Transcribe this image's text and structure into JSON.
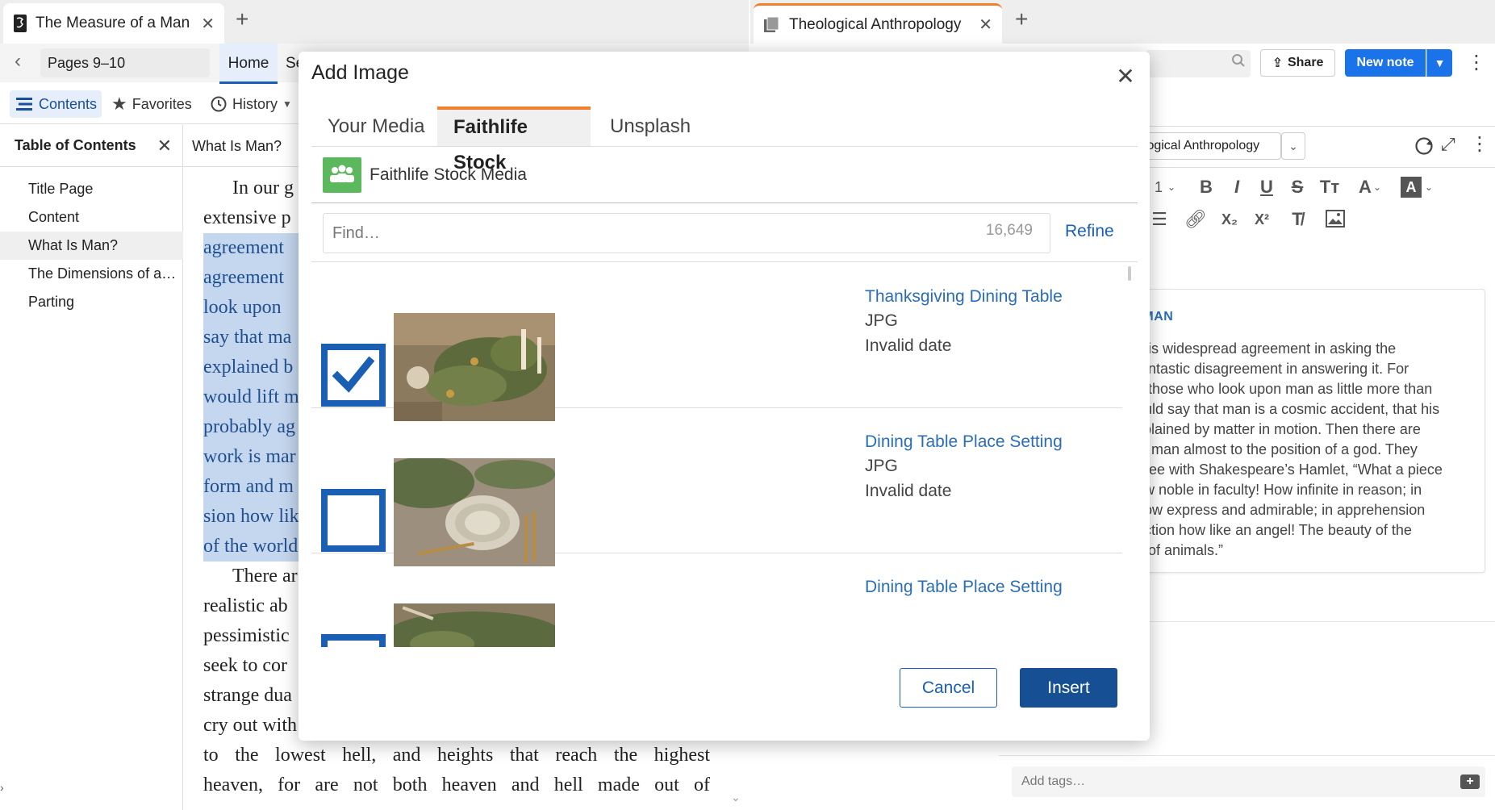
{
  "left_window": {
    "tab_title": "The Measure of a Man",
    "pages_field": "Pages 9–10",
    "home_tab": "Home",
    "home_tab_next_partial": "Se",
    "toolbar": {
      "contents": "Contents",
      "favorites": "Favorites",
      "history": "History"
    },
    "toc": {
      "title": "Table of Contents",
      "items": [
        "Title Page",
        "Content",
        "What Is Man?",
        "The Dimensions of a…",
        "Parting"
      ]
    },
    "chapter_title": "What Is Man?",
    "reader_lines": [
      "In our g",
      "extensive p",
      "agreement",
      "agreement",
      "look upon",
      "say that ma",
      "explained b",
      "would lift m",
      "probably ag",
      "work is mar",
      "form and m",
      "sion how lik",
      "of the world",
      "There ar",
      "realistic ab",
      "pessimistic",
      "seek to cor",
      "strange dua",
      "cry out with",
      "to the lowest hell, and heights that reach the highest",
      "heaven, for are not both heaven and hell made out of"
    ]
  },
  "right_window": {
    "tab_title": "Theological Anthropology",
    "share": "Share",
    "new_note": "New note",
    "notebook": "ological Anthropology",
    "format_partial_size": "1",
    "note": {
      "heading": "A MAN",
      "lines": [
        "e is widespread agreement in asking the",
        "fantastic disagreement in answering it. For",
        "e those who look upon man as little more than",
        "ould say that man is a cosmic accident, that his",
        "xplained by matter in motion. Then there are",
        "ift man almost to the position of a god. They",
        "gree with Shakespeare’s Hamlet, “What a piece",
        "ow noble in faculty! How infinite in reason; in",
        "now express and admirable; in apprehension",
        "action how like an angel! The beauty of the",
        "n of animals.”"
      ]
    },
    "tags_placeholder": "Add tags…"
  },
  "modal": {
    "title": "Add Image",
    "tabs": [
      "Your Media",
      "Faithlife Stock",
      "Unsplash"
    ],
    "active_tab": 1,
    "provider": "Faithlife Stock Media",
    "find_placeholder": "Find…",
    "find_count": "16,649",
    "refine": "Refine",
    "results": [
      {
        "title": "Thanksgiving Dining Table",
        "format": "JPG",
        "date": "Invalid date",
        "checked": true
      },
      {
        "title": "Dining Table Place Setting",
        "format": "JPG",
        "date": "Invalid date",
        "checked": false
      },
      {
        "title": "Dining Table Place Setting",
        "format": "",
        "date": "",
        "checked": false
      }
    ],
    "cancel": "Cancel",
    "insert": "Insert"
  },
  "colors": {
    "accent_blue": "#1a5fb4",
    "tab_orange": "#f08030",
    "primary_button": "#164f93",
    "highlight": "#c5d7ef"
  }
}
